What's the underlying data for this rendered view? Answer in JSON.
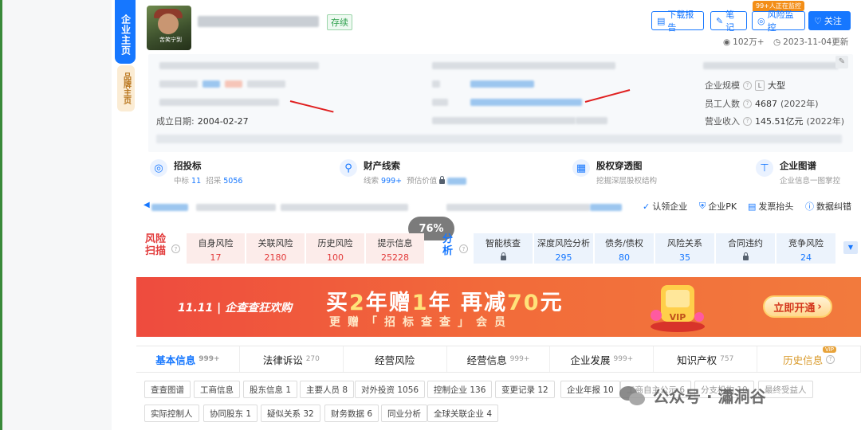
{
  "side": {
    "tab_main": "企业主页",
    "tab_brand": "品牌主页"
  },
  "header": {
    "logo_caption": "苦笑宁到",
    "status": "存续",
    "download_label": "下载报告",
    "notes_label": "笔记",
    "monitor_badge": "99+人正在监控",
    "monitor_label": "风险监控",
    "follow_label": "关注",
    "views": "102万+",
    "updated": "2023-11-04更新"
  },
  "info": {
    "founded_label": "成立日期:",
    "founded_value": "2004-02-27",
    "scale_label": "企业规模",
    "scale_badge": "L",
    "scale_value": "大型",
    "staff_label": "员工人数",
    "staff_value": "4687",
    "staff_year": "(2022年)",
    "revenue_label": "营业收入",
    "revenue_value": "145.51亿元",
    "revenue_year": "(2022年)"
  },
  "features": [
    {
      "title": "招投标",
      "sub_a_label": "中标",
      "sub_a_value": "11",
      "sub_b_label": "招采",
      "sub_b_value": "5056"
    },
    {
      "title": "财产线索",
      "sub_a_label": "线索",
      "sub_a_value": "999+",
      "sub_b_label": "预估价值"
    },
    {
      "title": "股权穿透图",
      "sub": "挖掘深层股权结构"
    },
    {
      "title": "企业图谱",
      "sub": "企业信息一图掌控"
    }
  ],
  "actions": {
    "claim": "认领企业",
    "pk": "企业PK",
    "invoice": "发票抬头",
    "correct": "数据纠错"
  },
  "progress_overlay": "76%",
  "risk": {
    "scan_label": "风险扫描",
    "analysis_label": "分析",
    "items": [
      {
        "label": "自身风险",
        "value": "17"
      },
      {
        "label": "关联风险",
        "value": "2180"
      },
      {
        "label": "历史风险",
        "value": "100"
      },
      {
        "label": "提示信息",
        "value": "25228"
      }
    ],
    "analysis": [
      {
        "label": "智能核查",
        "value": ""
      },
      {
        "label": "深度风险分析",
        "value": "295"
      },
      {
        "label": "债务/债权",
        "value": "80"
      },
      {
        "label": "风险关系",
        "value": "35"
      },
      {
        "label": "合同违约",
        "value": ""
      },
      {
        "label": "竞争风险",
        "value": "24"
      }
    ]
  },
  "banner": {
    "left": "11.11 | 企查查狂欢购",
    "main_a": "买",
    "main_b": "2",
    "main_c": "年赠",
    "main_d": "1",
    "main_e": "年 再减",
    "main_f": "70",
    "main_g": "元",
    "sub": "更赠「招标查查」会员",
    "gift_label": "VIP",
    "cta": "立即开通"
  },
  "tabs": [
    {
      "label": "基本信息",
      "count": "999+"
    },
    {
      "label": "法律诉讼",
      "count": "270"
    },
    {
      "label": "经营风险",
      "count": ""
    },
    {
      "label": "经营信息",
      "count": "999+"
    },
    {
      "label": "企业发展",
      "count": "999+"
    },
    {
      "label": "知识产权",
      "count": "757"
    },
    {
      "label": "历史信息",
      "count": "",
      "vip": "VIP"
    }
  ],
  "chips_row1": [
    "查查图谱",
    "工商信息",
    "股东信息 1",
    "主要人员 8",
    "对外投资 1056",
    "控制企业 136",
    "变更记录 12",
    "企业年报 10",
    "工商自主公示 6",
    "分支机构 10",
    "最终受益人"
  ],
  "chips_row2": [
    "实际控制人",
    "协同股东 1",
    "疑似关系 32",
    "财务数据 6",
    "同业分析",
    "全球关联企业 4"
  ],
  "watermark": "公众号 · 瀟洞谷"
}
